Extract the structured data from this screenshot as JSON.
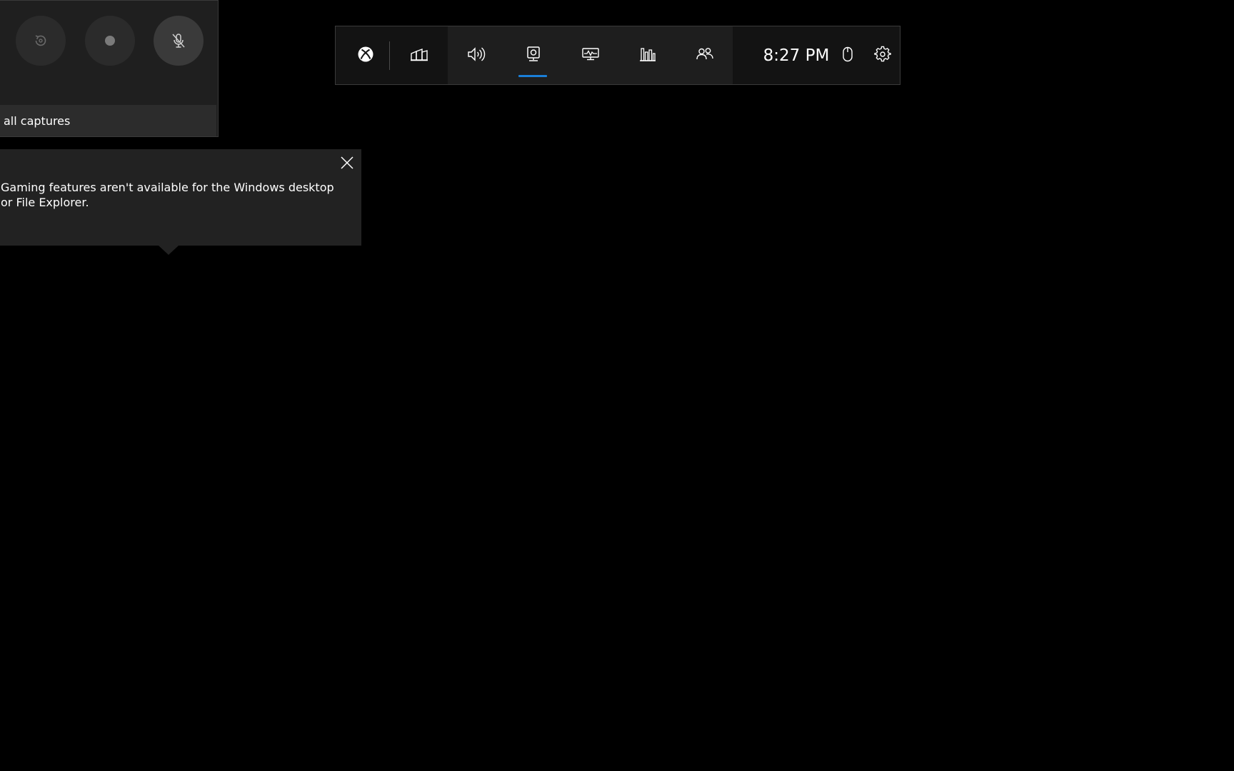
{
  "capture_widget": {
    "buttons": [
      {
        "icon": "replay-icon"
      },
      {
        "icon": "record-dot-icon"
      },
      {
        "icon": "mic-off-icon"
      }
    ],
    "show_all_label": "all captures"
  },
  "notice": {
    "message": "Gaming features aren't available for the Windows desktop or File Explorer."
  },
  "gamebar": {
    "items": [
      {
        "icon": "xbox-icon"
      },
      {
        "icon": "widget-menu-icon"
      },
      {
        "icon": "audio-icon"
      },
      {
        "icon": "capture-icon",
        "active": true
      },
      {
        "icon": "performance-icon"
      },
      {
        "icon": "resources-icon"
      },
      {
        "icon": "social-icon"
      },
      {
        "icon": "mouse-icon"
      },
      {
        "icon": "settings-gear-icon"
      }
    ],
    "clock": "8:27 PM"
  },
  "colors": {
    "background": "#000000",
    "panel": "#1f1f1f",
    "accent": "#1a7fd8",
    "text": "#ffffff"
  }
}
